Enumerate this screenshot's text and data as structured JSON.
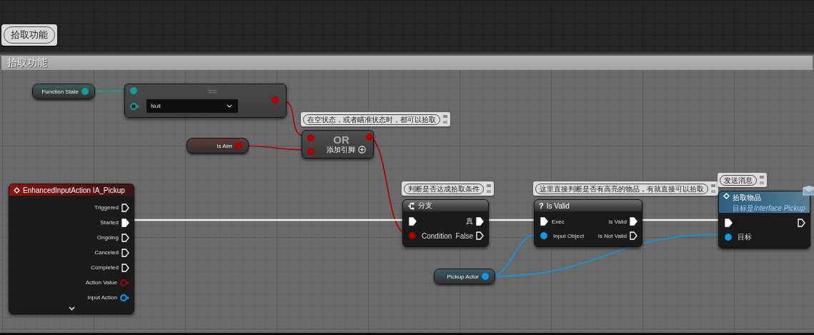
{
  "top_bubble": "拾取功能",
  "comment_box": {
    "title": "拾取功能"
  },
  "nodes": [
    {
      "kind": "variable",
      "label": "Function State",
      "pin": {
        "kind": "data",
        "color": "#12a090",
        "connected": true
      }
    },
    {
      "kind": "compare",
      "title": "==",
      "dropdown": "Null",
      "inputs": [
        {
          "kind": "data",
          "color": "#12a090",
          "connected": true
        },
        {
          "kind": "data",
          "color": "#12a090",
          "connected": false
        }
      ],
      "output": {
        "kind": "data",
        "color": "#b00000",
        "connected": true
      }
    },
    {
      "kind": "variable",
      "label": "Is Aim",
      "pin": {
        "kind": "data",
        "color": "#b00000",
        "connected": true
      }
    },
    {
      "kind": "or",
      "comment": "在空状态，或者瞄准状态时，都可以拾取",
      "title": "OR",
      "add_pin": "添加引脚",
      "inputs": [
        {
          "kind": "data",
          "color": "#b00000",
          "connected": true
        },
        {
          "kind": "data",
          "color": "#b00000",
          "connected": true
        }
      ],
      "output": {
        "kind": "data",
        "color": "#b00000",
        "connected": true
      }
    },
    {
      "kind": "event",
      "title": "EnhancedInputAction IA_Pickup",
      "rows": [
        {
          "out": {
            "label": "Triggered",
            "kind": "exec",
            "connected": false
          }
        },
        {
          "out": {
            "label": "Started",
            "kind": "exec",
            "connected": true
          }
        },
        {
          "out": {
            "label": "Ongoing",
            "kind": "exec",
            "connected": false
          }
        },
        {
          "out": {
            "label": "Canceled",
            "kind": "exec",
            "connected": false
          }
        },
        {
          "out": {
            "label": "Completed",
            "kind": "exec",
            "connected": false
          }
        },
        {
          "out": {
            "label": "Action Value",
            "kind": "data",
            "color": "#8a0a0a",
            "connected": false
          }
        },
        {
          "out": {
            "label": "Input Action",
            "kind": "data",
            "color": "#0a9ae8",
            "connected": false
          }
        }
      ]
    },
    {
      "kind": "branch",
      "comment": "判断是否达成拾取条件",
      "title": "分支",
      "rows": [
        {
          "in": {
            "kind": "exec",
            "connected": true
          },
          "out": {
            "label": "真",
            "kind": "exec",
            "connected": true
          }
        },
        {
          "in": {
            "label": "Condition",
            "kind": "data",
            "color": "#b00000",
            "connected": true
          },
          "out": {
            "label": "False",
            "kind": "exec",
            "connected": false
          }
        }
      ]
    },
    {
      "kind": "function",
      "comment": "这里直接判断是否有高亮的物品，有就直接可以拾取",
      "icon": "?",
      "title": "Is Valid",
      "rows": [
        {
          "in": {
            "label": "Exec",
            "kind": "exec",
            "connected": true
          },
          "out": {
            "label": "Is Valid",
            "kind": "exec",
            "connected": true
          }
        },
        {
          "in": {
            "label": "Input Object",
            "kind": "data",
            "color": "#0a9ae8",
            "connected": true
          },
          "out": {
            "label": "Is Not Valid",
            "kind": "exec",
            "connected": false
          }
        }
      ]
    },
    {
      "kind": "variable",
      "label": "Pickup Actor",
      "pin": {
        "kind": "data",
        "color": "#0a9ae8",
        "connected": true
      }
    },
    {
      "kind": "message",
      "comment": "发送消息",
      "title": "拾取物品",
      "subtitle": {
        "prefix": "目标是",
        "target": "Interface Pickup"
      },
      "rows": [
        {
          "in": {
            "kind": "exec",
            "connected": true
          },
          "out": {
            "kind": "exec",
            "connected": false
          }
        },
        {
          "in": {
            "label": "目标",
            "kind": "data",
            "color": "#0a9ae8",
            "connected": true
          }
        }
      ]
    }
  ]
}
